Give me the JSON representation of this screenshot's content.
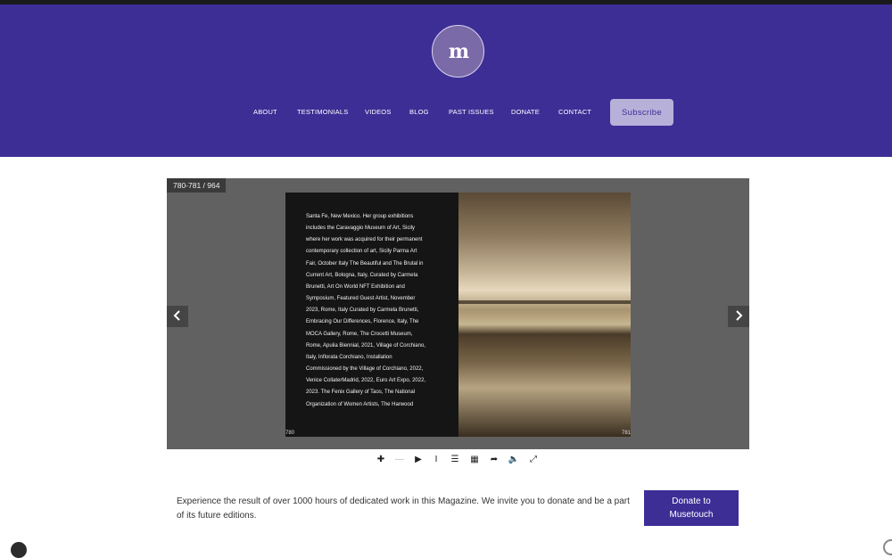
{
  "header": {
    "logo_text": "m",
    "nav": [
      {
        "label": "ABOUT"
      },
      {
        "label": "TESTIMONIALS"
      },
      {
        "label": "VIDEOS"
      },
      {
        "label": "BLOG"
      },
      {
        "label": "PAST ISSUES"
      },
      {
        "label": "DONATE"
      },
      {
        "label": "CONTACT"
      }
    ],
    "subscribe_label": "Subscribe"
  },
  "viewer": {
    "page_counter": "780-781 / 964",
    "left_page_number": "780",
    "right_page_number": "781",
    "left_page_text": [
      "Santa Fe, New Mexico. Her group exhibitions",
      "includes the Caravaggio Museum of Art, Sicily",
      "where her work was acquired for their permanent",
      "contemporary collection of art, Sicily Parma Art",
      "Fair, October Italy The Beautiful and The Brutal in",
      "Current Art, Bologna, Italy, Curated by Carmela",
      "Brunetti, Art On World NFT Exhibition and",
      "Symposium, Featured Guest Artist, November",
      "2023, Rome, Italy Curated by Carmela Brunetti,",
      "Embracing Our Differences, Florence, Italy, The",
      "MOCA Gallery, Rome, The Crocetti Museum,",
      "Rome, Apulia Biennial, 2021, Village of Corchiano,",
      "Italy, Inflorata Corchiano, Installation",
      "Commissioned by the Village of Corchiano, 2022,",
      "Venice CollaterMadrid, 2022, Euro Art Expo, 2022,",
      "2023. The Fenix Gallery of Taos, The National",
      "Organization of Women Artists, The Harwood"
    ],
    "prev_icon": "chevron-left-icon",
    "next_icon": "chevron-right-icon"
  },
  "toolbar": {
    "tools": [
      {
        "name": "zoom-in-icon",
        "glyph": "✚"
      },
      {
        "name": "zoom-out-icon",
        "glyph": "—"
      },
      {
        "name": "play-icon",
        "glyph": "▶"
      },
      {
        "name": "text-select-icon",
        "glyph": "I"
      },
      {
        "name": "toc-icon",
        "glyph": "☰"
      },
      {
        "name": "thumbnails-icon",
        "glyph": "▦"
      },
      {
        "name": "share-icon",
        "glyph": "➦"
      },
      {
        "name": "sound-icon",
        "glyph": "🔈"
      },
      {
        "name": "fullscreen-icon",
        "glyph": "⤢"
      }
    ]
  },
  "cta": {
    "text": "Experience the result of over 1000 hours of dedicated work in this Magazine. We invite you to donate and be a part of its future editions.",
    "donate_line1": "Donate to",
    "donate_line2": "Musetouch"
  },
  "colors": {
    "brand": "#3d2e96",
    "subscribe_bg": "#b7b1d9",
    "viewer_bg": "#616161"
  }
}
